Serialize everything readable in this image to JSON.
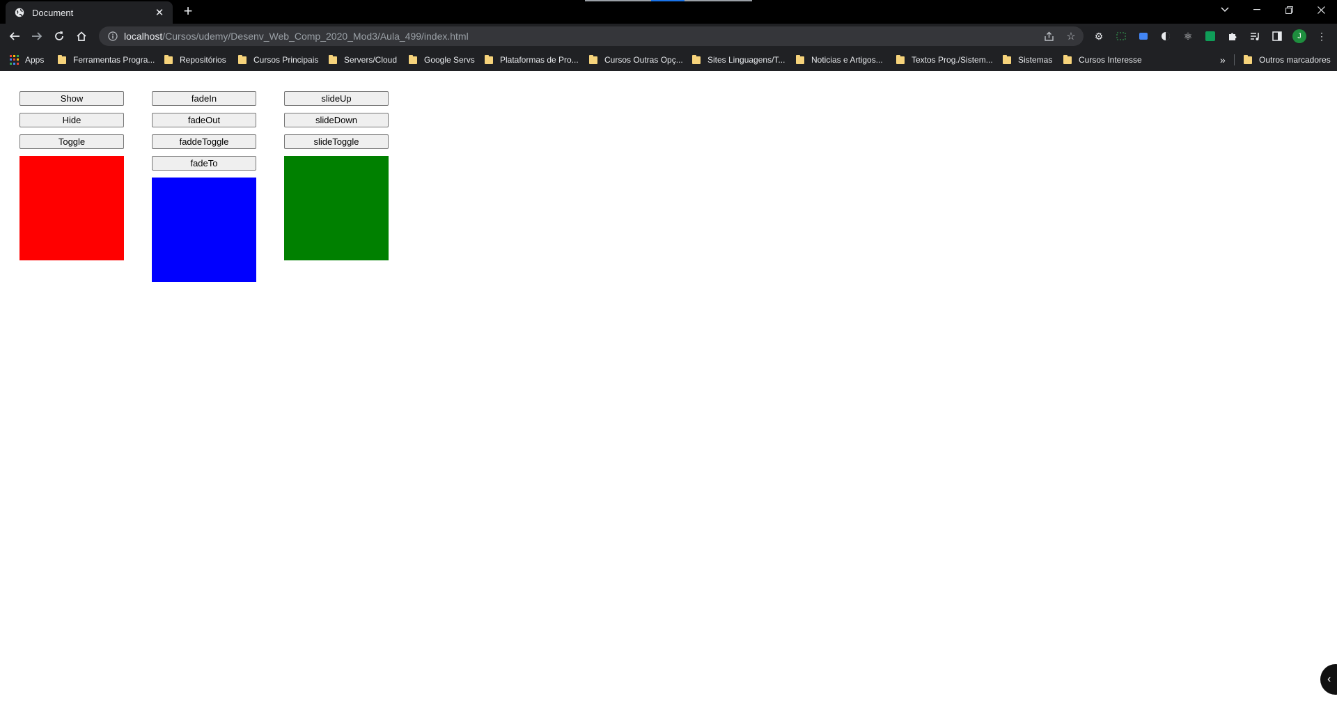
{
  "browser": {
    "tab": {
      "title": "Document",
      "close_icon": "close-icon"
    },
    "new_tab_symbol": "+",
    "url": {
      "host": "localhost",
      "path": "/Cursos/udemy/Desenv_Web_Comp_2020_Mod3/Aula_499/index.html"
    },
    "profile_initial": "J",
    "bookmarks": {
      "apps": "Apps",
      "items": [
        "Ferramentas Progra...",
        "Repositórios",
        "Cursos Principais",
        "Servers/Cloud",
        "Google Servs",
        "Plataformas de Pro...",
        "Cursos Outras Opç...",
        "Sites Linguagens/T...",
        "Noticias e Artigos...",
        "Textos Prog./Sistem...",
        "Sistemas",
        "Cursos Interesse"
      ],
      "overflow": "»",
      "other": "Outros marcadores"
    }
  },
  "page": {
    "col1": {
      "buttons": [
        "Show",
        "Hide",
        "Toggle"
      ],
      "box_color": "#ff0000"
    },
    "col2": {
      "buttons": [
        "fadeIn",
        "fadeOut",
        "faddeToggle",
        "fadeTo"
      ],
      "box_color": "#0000ff"
    },
    "col3": {
      "buttons": [
        "slideUp",
        "slideDown",
        "slideToggle"
      ],
      "box_color": "#008000"
    }
  },
  "colors": {
    "chrome_bg": "#000000",
    "toolbar_bg": "#202124",
    "omnibox_bg": "#35363a",
    "profile": "#1e8e3e"
  }
}
